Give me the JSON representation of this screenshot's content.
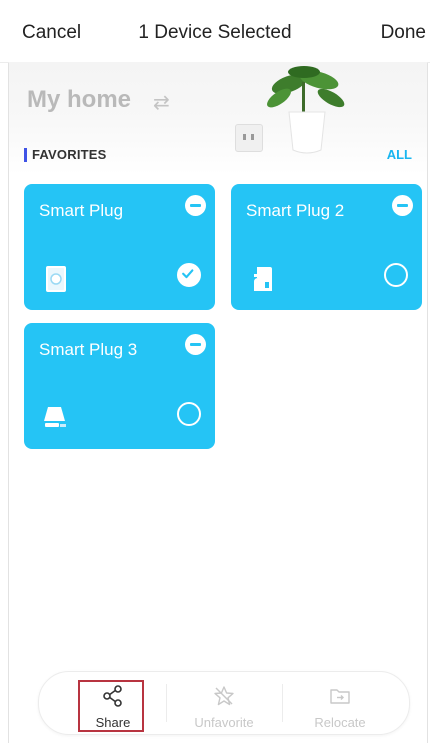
{
  "topbar": {
    "cancel_label": "Cancel",
    "title": "1 Device Selected",
    "done_label": "Done"
  },
  "home": {
    "title": "My home",
    "swap_icon": "swap-arrows-icon"
  },
  "favorites": {
    "section_label": "FAVORITES",
    "all_label": "ALL",
    "devices": [
      {
        "name": "Smart Plug",
        "icon": "smart-plug-icon",
        "selected": true
      },
      {
        "name": "Smart Plug 2",
        "icon": "smart-plug-side-icon",
        "selected": false
      },
      {
        "name": "Smart Plug 3",
        "icon": "smart-plug-lamp-icon",
        "selected": false
      }
    ]
  },
  "actions": {
    "share_label": "Share",
    "unfavorite_label": "Unfavorite",
    "relocate_label": "Relocate"
  },
  "colors": {
    "card": "#25c4f5",
    "accent_blue": "#19b6f0",
    "favorites_bar": "#3f53e6",
    "highlight_box": "#b83440"
  }
}
